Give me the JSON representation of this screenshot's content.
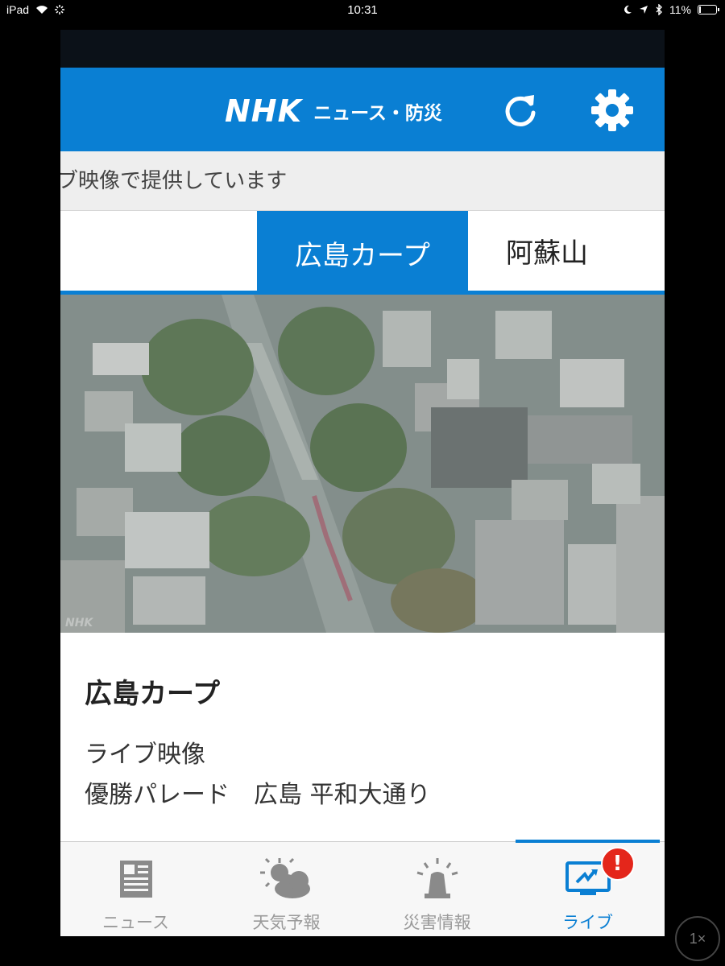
{
  "status_bar": {
    "device": "iPad",
    "time": "10:31",
    "battery": "11%"
  },
  "header": {
    "logo_nhk": "NHK",
    "logo_sub": "ニュース・防災"
  },
  "ticker": {
    "text": "イブ映像で提供しています"
  },
  "tabs": [
    {
      "label": "広島カープ",
      "active": true
    },
    {
      "label": "阿蘇山",
      "active": false
    }
  ],
  "video": {
    "watermark": "NHK"
  },
  "info": {
    "title": "広島カープ",
    "line1": "ライブ映像",
    "line2": "優勝パレード　広島 平和大通り"
  },
  "tabbar": {
    "items": [
      {
        "label": "ニュース",
        "icon": "newspaper-icon"
      },
      {
        "label": "天気予報",
        "icon": "weather-icon"
      },
      {
        "label": "災害情報",
        "icon": "siren-icon"
      },
      {
        "label": "ライブ",
        "icon": "live-tv-icon"
      }
    ],
    "badge": "!"
  },
  "zoom": "1×",
  "colors": {
    "brand": "#0a7fd3",
    "badge": "#e4261b"
  }
}
